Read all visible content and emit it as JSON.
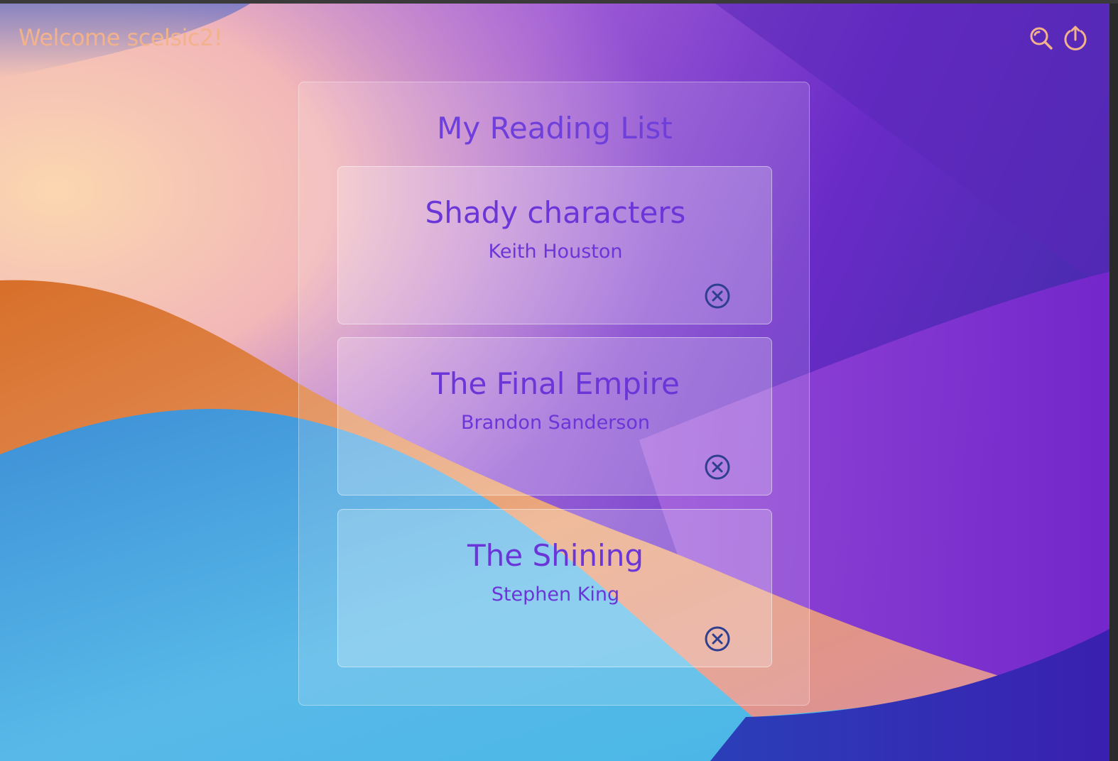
{
  "header": {
    "welcome_text": "Welcome scelsic2!",
    "search_icon": "search-icon",
    "logout_icon": "power-icon"
  },
  "reading_list": {
    "title": "My Reading List",
    "books": [
      {
        "title": "Shady characters",
        "author": "Keith Houston",
        "remove_icon": "close-circle-icon"
      },
      {
        "title": "The Final Empire",
        "author": "Brandon Sanderson",
        "remove_icon": "close-circle-icon"
      },
      {
        "title": "The Shining",
        "author": "Stephen King",
        "remove_icon": "close-circle-icon"
      }
    ]
  },
  "colors": {
    "welcome": "#f2b28c",
    "accent_purple": "#6a36d8",
    "remove_icon": "#2e3f8f"
  }
}
